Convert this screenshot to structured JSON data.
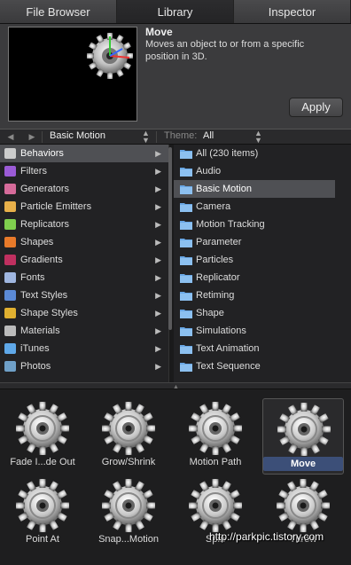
{
  "tabs": [
    "File Browser",
    "Library",
    "Inspector"
  ],
  "preview": {
    "title": "Move",
    "description": "Moves an object to or from a specific position in 3D.",
    "apply_label": "Apply"
  },
  "nav": {
    "back_icon": "back-arrow-icon",
    "forward_icon": "forward-arrow-icon",
    "library_selected": "Basic Motion",
    "theme_label": "Theme:",
    "theme_value": "All"
  },
  "categories": [
    {
      "label": "Behaviors",
      "icon": "behaviors-icon",
      "color": "#cccccc"
    },
    {
      "label": "Filters",
      "icon": "filters-icon",
      "color": "#9b5bd6"
    },
    {
      "label": "Generators",
      "icon": "generators-icon",
      "color": "#d66b9a"
    },
    {
      "label": "Particle Emitters",
      "icon": "particle-emitters-icon",
      "color": "#e8b04a"
    },
    {
      "label": "Replicators",
      "icon": "replicators-icon",
      "color": "#7fcf4e"
    },
    {
      "label": "Shapes",
      "icon": "shapes-icon",
      "color": "#e87a2a"
    },
    {
      "label": "Gradients",
      "icon": "gradients-icon",
      "color": "#c03060"
    },
    {
      "label": "Fonts",
      "icon": "fonts-icon",
      "color": "#9fb6e0"
    },
    {
      "label": "Text Styles",
      "icon": "text-styles-icon",
      "color": "#5b8ad6"
    },
    {
      "label": "Shape Styles",
      "icon": "shape-styles-icon",
      "color": "#e0b030"
    },
    {
      "label": "Materials",
      "icon": "materials-icon",
      "color": "#bbbbbb"
    },
    {
      "label": "iTunes",
      "icon": "itunes-icon",
      "color": "#5fa8e8"
    },
    {
      "label": "Photos",
      "icon": "photos-icon",
      "color": "#6fa0c8"
    }
  ],
  "subcategories": [
    "All (230 items)",
    "Audio",
    "Basic Motion",
    "Camera",
    "Motion Tracking",
    "Parameter",
    "Particles",
    "Replicator",
    "Retiming",
    "Shape",
    "Simulations",
    "Text Animation",
    "Text Sequence"
  ],
  "selected_subcategory_index": 2,
  "thumbnails": [
    {
      "label": "Fade I...de Out",
      "selected": false
    },
    {
      "label": "Grow/Shrink",
      "selected": false
    },
    {
      "label": "Motion Path",
      "selected": false
    },
    {
      "label": "Move",
      "selected": true
    },
    {
      "label": "Point At",
      "selected": false
    },
    {
      "label": "Snap...Motion",
      "selected": false
    },
    {
      "label": "Spin",
      "selected": false
    },
    {
      "label": "Throw",
      "selected": false
    }
  ],
  "watermark": "http://parkpic.tistory.com",
  "colors": {
    "selection_row": "#4f5054",
    "selected_thumb_label": "#3c4f78",
    "folder": "#6aa8e6"
  }
}
